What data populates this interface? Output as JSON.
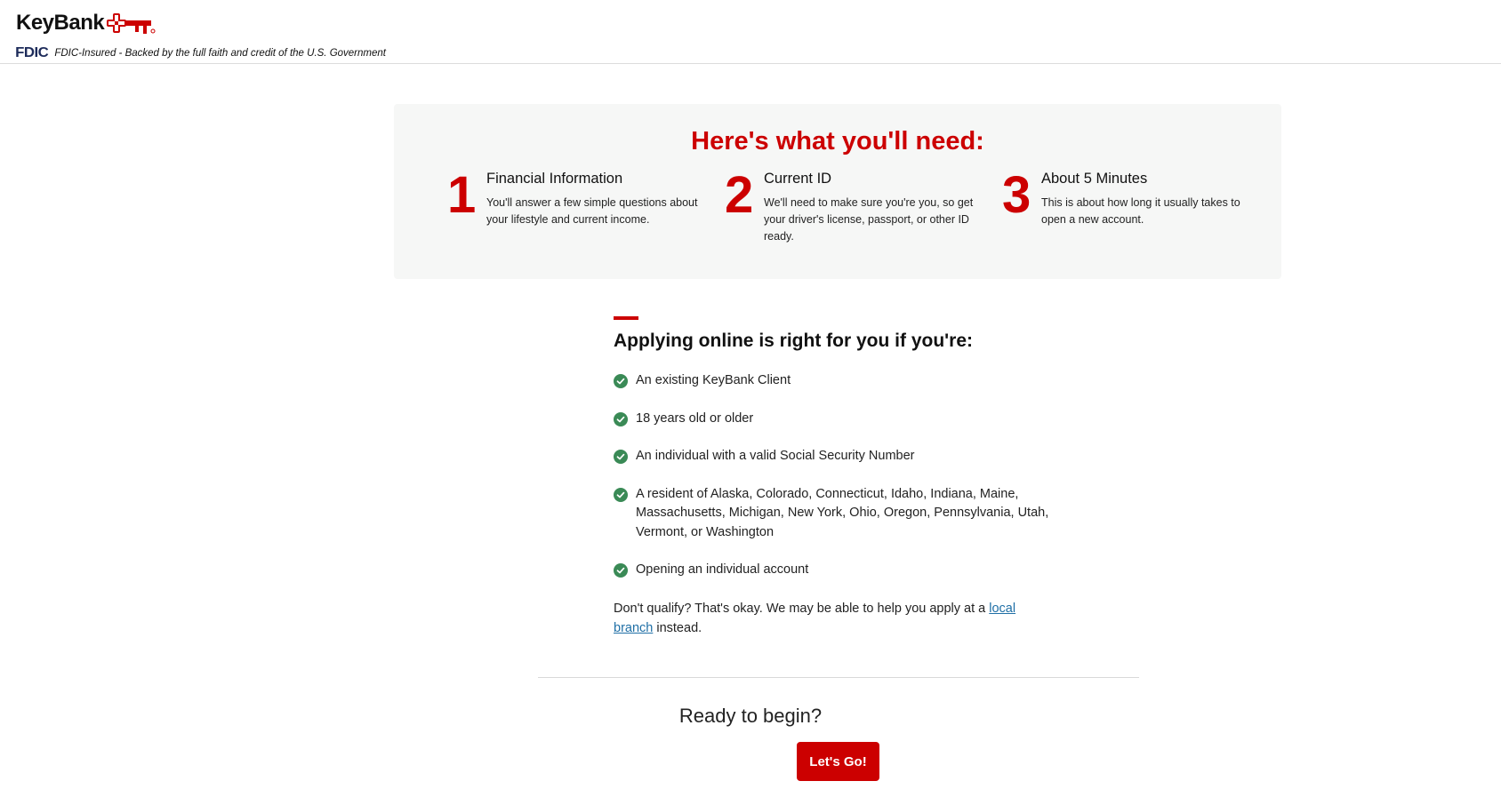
{
  "header": {
    "brand": "KeyBank",
    "fdic_mark": "FDIC",
    "fdic_text": "FDIC-Insured - Backed by the full faith and credit of the U.S. Government"
  },
  "needs": {
    "title": "Here's what you'll need:",
    "steps": [
      {
        "number": "1",
        "title": "Financial Information",
        "desc": "You'll answer a few simple questions about your lifestyle and current income."
      },
      {
        "number": "2",
        "title": "Current ID",
        "desc": "We'll need to make sure you're you, so get your driver's license, passport, or other ID ready."
      },
      {
        "number": "3",
        "title": "About 5 Minutes",
        "desc": "This is about how long it usually takes to open a new account."
      }
    ]
  },
  "eligibility": {
    "title": "Applying online is right for you if you're:",
    "items": [
      "An existing KeyBank Client",
      "18 years old or older",
      "An individual with a valid Social Security Number",
      "A resident of Alaska, Colorado, Connecticut, Idaho, Indiana, Maine, Massachusetts, Michigan, New York, Ohio, Oregon, Pennsylvania, Utah, Vermont, or Washington",
      "Opening an individual account"
    ],
    "qualify_prefix": "Don't qualify? That's okay. We may be able to help you apply at a ",
    "qualify_link": "local branch",
    "qualify_suffix": " instead."
  },
  "cta": {
    "prompt": "Ready to begin?",
    "button_label": "Let's Go!"
  },
  "colors": {
    "brand_red": "#cc0000",
    "check_green": "#3a8a56",
    "link_blue": "#1f6fa6"
  }
}
